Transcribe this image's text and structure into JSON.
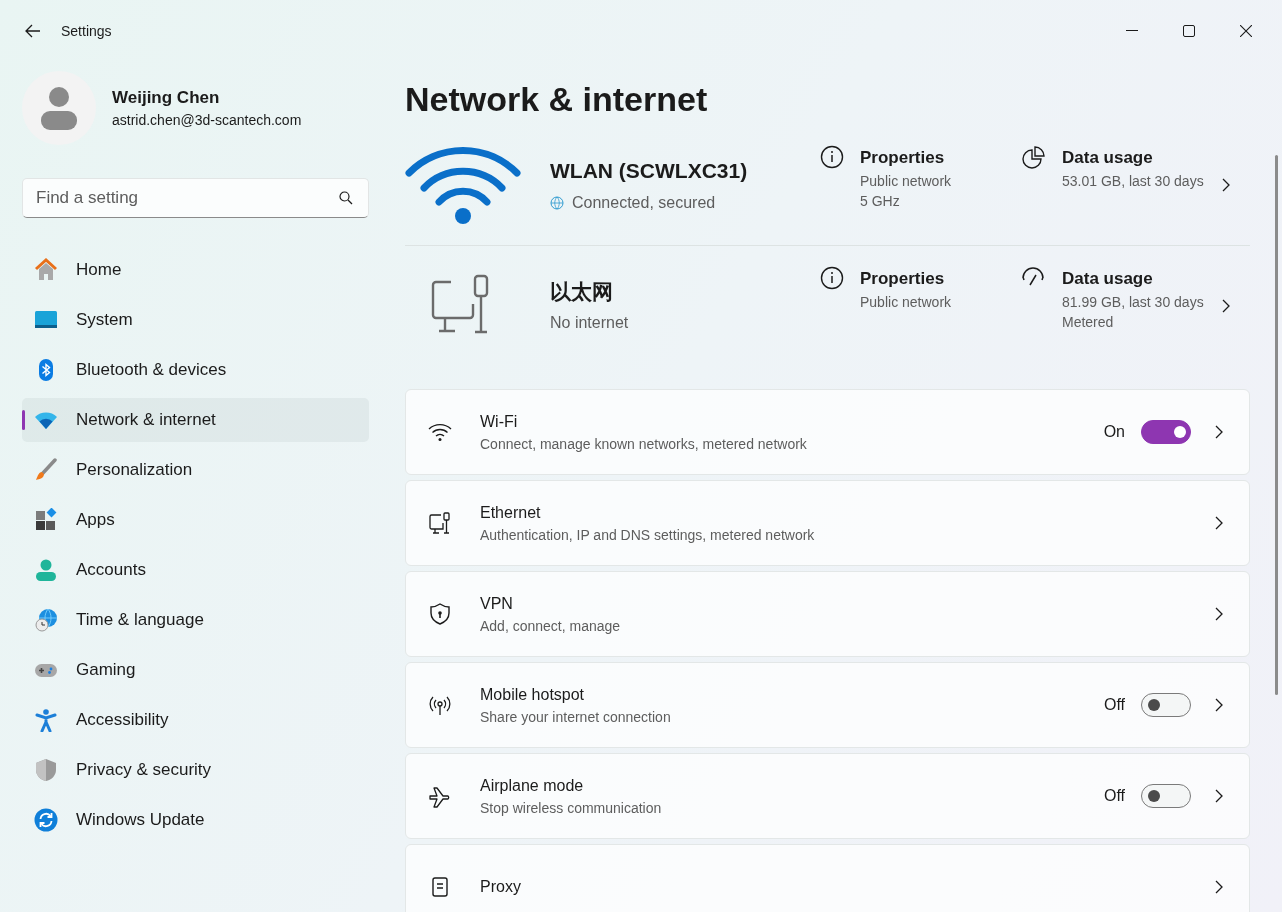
{
  "window": {
    "title": "Settings"
  },
  "user": {
    "name": "Weijing Chen",
    "email": "astrid.chen@3d-scantech.com"
  },
  "search": {
    "placeholder": "Find a setting"
  },
  "nav": [
    {
      "kind": "home",
      "label": "Home",
      "selected": false
    },
    {
      "kind": "system",
      "label": "System",
      "selected": false
    },
    {
      "kind": "bluetooth",
      "label": "Bluetooth & devices",
      "selected": false
    },
    {
      "kind": "network",
      "label": "Network & internet",
      "selected": true
    },
    {
      "kind": "personalization",
      "label": "Personalization",
      "selected": false
    },
    {
      "kind": "apps",
      "label": "Apps",
      "selected": false
    },
    {
      "kind": "accounts",
      "label": "Accounts",
      "selected": false
    },
    {
      "kind": "time",
      "label": "Time & language",
      "selected": false
    },
    {
      "kind": "gaming",
      "label": "Gaming",
      "selected": false
    },
    {
      "kind": "accessibility",
      "label": "Accessibility",
      "selected": false
    },
    {
      "kind": "privacy",
      "label": "Privacy & security",
      "selected": false
    },
    {
      "kind": "update",
      "label": "Windows Update",
      "selected": false
    }
  ],
  "page_title": "Network & internet",
  "connections": [
    {
      "kind": "wifi",
      "name": "WLAN (SCWLXC31)",
      "status": "Connected, secured",
      "properties": {
        "title": "Properties",
        "lines": [
          "Public network",
          "5 GHz"
        ]
      },
      "usage": {
        "kind": "pie",
        "title": "Data usage",
        "lines": [
          "53.01 GB, last 30 days"
        ]
      }
    },
    {
      "kind": "ethernet",
      "name": "以太网",
      "status": "No internet",
      "properties": {
        "title": "Properties",
        "lines": [
          "Public network"
        ]
      },
      "usage": {
        "kind": "gauge",
        "title": "Data usage",
        "lines": [
          "81.99 GB, last 30 days",
          "Metered"
        ]
      }
    }
  ],
  "settings": [
    {
      "kind": "wifi",
      "title": "Wi-Fi",
      "subtitle": "Connect, manage known networks, metered network",
      "toggle": {
        "label": "On",
        "on": true
      }
    },
    {
      "kind": "ethernet",
      "title": "Ethernet",
      "subtitle": "Authentication, IP and DNS settings, metered network"
    },
    {
      "kind": "vpn",
      "title": "VPN",
      "subtitle": "Add, connect, manage"
    },
    {
      "kind": "hotspot",
      "title": "Mobile hotspot",
      "subtitle": "Share your internet connection",
      "toggle": {
        "label": "Off",
        "on": false
      }
    },
    {
      "kind": "airplane",
      "title": "Airplane mode",
      "subtitle": "Stop wireless communication",
      "toggle": {
        "label": "Off",
        "on": false
      }
    },
    {
      "kind": "proxy",
      "title": "Proxy"
    }
  ]
}
